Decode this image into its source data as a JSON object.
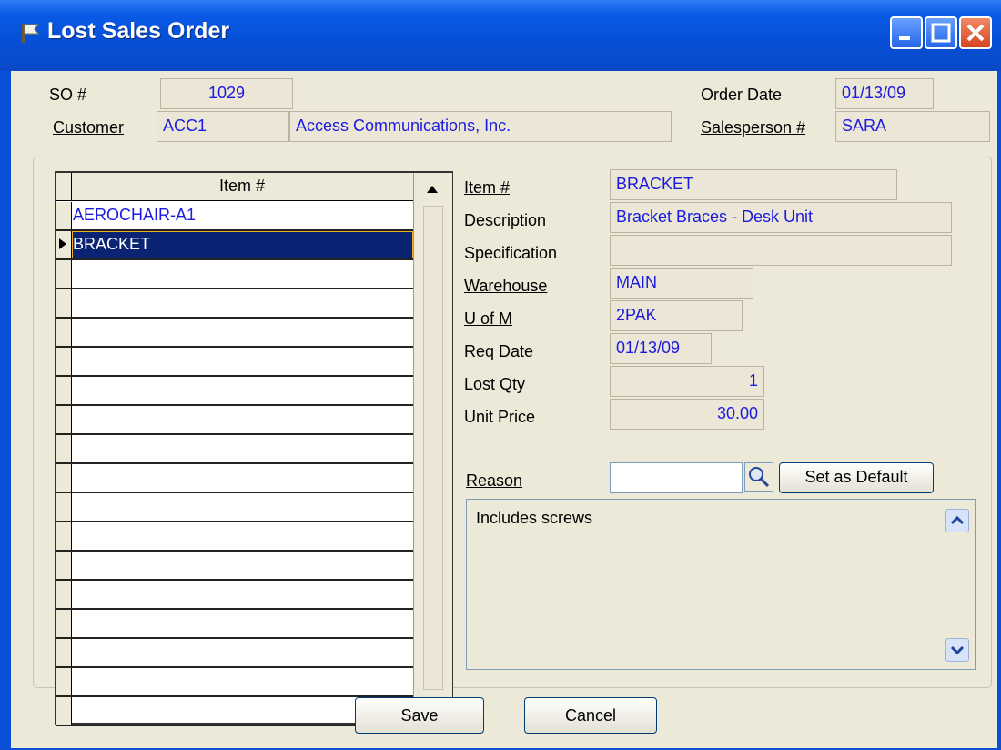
{
  "window": {
    "title": "Lost Sales Order"
  },
  "header": {
    "so_label": "SO #",
    "so_value": "1029",
    "customer_label": "Customer",
    "customer_code": "ACC1",
    "customer_name": "Access Communications, Inc.",
    "order_date_label": "Order Date",
    "order_date_value": "01/13/09",
    "salesperson_label": "Salesperson #",
    "salesperson_value": "SARA"
  },
  "grid": {
    "header": "Item #",
    "rows": [
      "AEROCHAIR-A1",
      "BRACKET",
      "",
      "",
      "",
      "",
      "",
      "",
      "",
      "",
      "",
      "",
      "",
      "",
      "",
      "",
      "",
      ""
    ],
    "selected_index": 1
  },
  "detail": {
    "item_label": "Item #",
    "item_value": "BRACKET",
    "description_label": "Description",
    "description_value": "Bracket Braces - Desk Unit",
    "specification_label": "Specification",
    "specification_value": "",
    "warehouse_label": "Warehouse",
    "warehouse_value": "MAIN",
    "uom_label": "U of M",
    "uom_value": "2PAK",
    "req_date_label": "Req Date",
    "req_date_value": "01/13/09",
    "lost_qty_label": "Lost Qty",
    "lost_qty_value": "1",
    "unit_price_label": "Unit Price",
    "unit_price_value": "30.00"
  },
  "reason": {
    "label": "Reason",
    "input_value": "",
    "set_default_label": "Set as Default",
    "memo_text": "Includes screws"
  },
  "footer": {
    "save_label": "Save",
    "cancel_label": "Cancel"
  },
  "colors": {
    "title_bar": "#0a5ae6",
    "value_text": "#1a1ae0",
    "selected_row": "#0a2473",
    "highlight_box": "#e01b1b"
  },
  "icons": [
    "flag-icon",
    "minimize-icon",
    "maximize-icon",
    "close-icon",
    "search-icon",
    "scroll-up-icon",
    "scroll-down-icon",
    "row-pointer-icon"
  ]
}
